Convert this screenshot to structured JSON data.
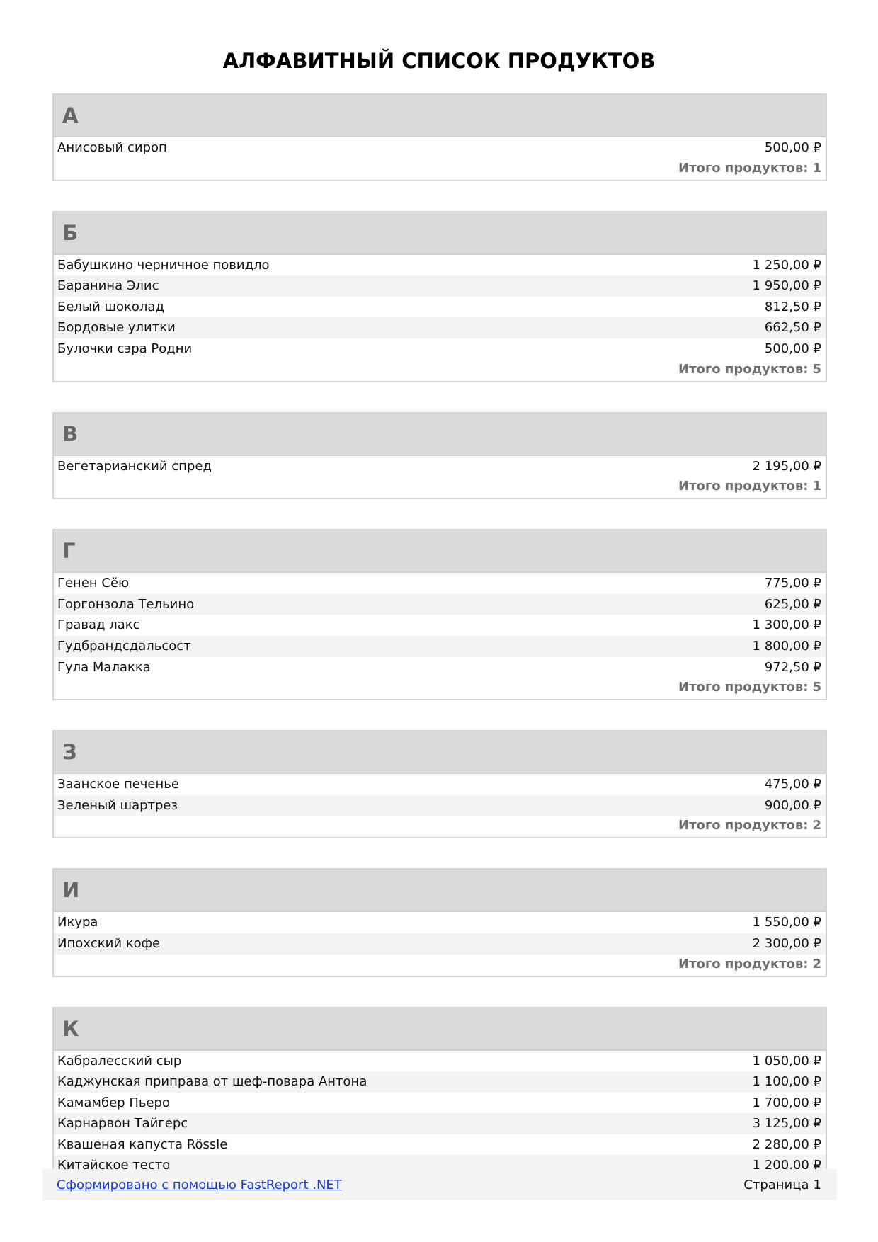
{
  "title": "АЛФАВИТНЫЙ СПИСОК ПРОДУКТОВ",
  "total_label": "Итого продуктов:",
  "groups": [
    {
      "letter": "А",
      "count": "1",
      "items": [
        {
          "name": "Анисовый сироп",
          "price": "500,00 ₽"
        }
      ]
    },
    {
      "letter": "Б",
      "count": "5",
      "items": [
        {
          "name": "Бабушкино черничное повидло",
          "price": "1 250,00 ₽"
        },
        {
          "name": "Баранина Элис",
          "price": "1 950,00 ₽"
        },
        {
          "name": "Белый шоколад",
          "price": "812,50 ₽"
        },
        {
          "name": "Бордовые улитки",
          "price": "662,50 ₽"
        },
        {
          "name": "Булочки сэра Родни",
          "price": "500,00 ₽"
        }
      ]
    },
    {
      "letter": "В",
      "count": "1",
      "items": [
        {
          "name": "Вегетарианский спред",
          "price": "2 195,00 ₽"
        }
      ]
    },
    {
      "letter": "Г",
      "count": "5",
      "items": [
        {
          "name": "Генен Сёю",
          "price": "775,00 ₽"
        },
        {
          "name": "Горгонзола Тельино",
          "price": "625,00 ₽"
        },
        {
          "name": "Гравад лакс",
          "price": "1 300,00 ₽"
        },
        {
          "name": "Гудбрандсдальсост",
          "price": "1 800,00 ₽"
        },
        {
          "name": "Гула Малакка",
          "price": "972,50 ₽"
        }
      ]
    },
    {
      "letter": "З",
      "count": "2",
      "items": [
        {
          "name": "Заанское печенье",
          "price": "475,00 ₽"
        },
        {
          "name": "Зеленый шартрез",
          "price": "900,00 ₽"
        }
      ]
    },
    {
      "letter": "И",
      "count": "2",
      "items": [
        {
          "name": "Икура",
          "price": "1 550,00 ₽"
        },
        {
          "name": "Ипохский кофе",
          "price": "2 300,00 ₽"
        }
      ]
    },
    {
      "letter": "К",
      "count": null,
      "items": [
        {
          "name": "Кабралесский сыр",
          "price": "1 050,00 ₽"
        },
        {
          "name": "Каджунская приправа от шеф-повара Антона",
          "price": "1 100,00 ₽"
        },
        {
          "name": "Камамбер Пьеро",
          "price": "1 700,00 ₽"
        },
        {
          "name": "Карнарвон Тайгерс",
          "price": "3 125,00 ₽"
        },
        {
          "name": "Квашеная капуста Rössle",
          "price": "2 280,00 ₽"
        },
        {
          "name": "Китайское тесто",
          "price": "1 200,00 ₽"
        }
      ]
    }
  ],
  "footer": {
    "link_text": "Сформировано с помощью FastReport .NET",
    "page_label": "Страница",
    "page_number": "1"
  }
}
